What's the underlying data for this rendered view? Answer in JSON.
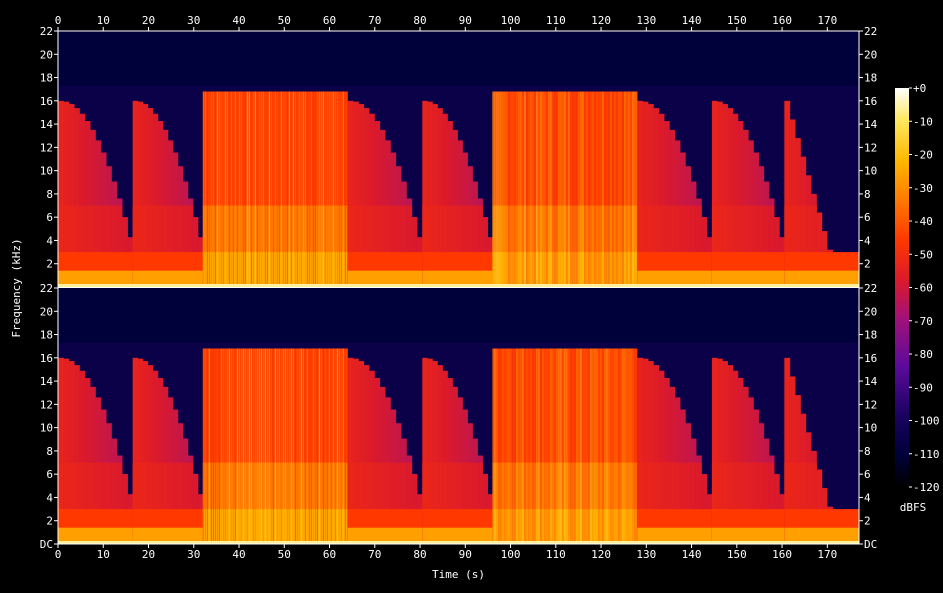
{
  "chart_data": {
    "type": "heatmap",
    "xlabel": "Time (s)",
    "ylabel": "Frequency (kHz)",
    "colorbar_label": "dBFS",
    "x_ticks": [
      0,
      10,
      20,
      30,
      40,
      50,
      60,
      70,
      80,
      90,
      100,
      110,
      120,
      130,
      140,
      150,
      160,
      170
    ],
    "xlim": [
      0,
      177
    ],
    "y_ticks": [
      "DC",
      "2",
      "4",
      "6",
      "8",
      "10",
      "12",
      "14",
      "16",
      "18",
      "20",
      "22"
    ],
    "ylim": [
      0,
      22
    ],
    "colorbar_ticks": [
      "+0",
      "-10",
      "-20",
      "-30",
      "-40",
      "-50",
      "-60",
      "-70",
      "-80",
      "-90",
      "-100",
      "-110",
      "-120"
    ],
    "colorbar_range": [
      -120,
      0
    ],
    "channels": [
      "ch1",
      "ch2"
    ],
    "segments": [
      {
        "start": 0,
        "end": 16.5,
        "kind": "decay"
      },
      {
        "start": 16.5,
        "end": 32,
        "kind": "decay"
      },
      {
        "start": 32,
        "end": 64,
        "kind": "full"
      },
      {
        "start": 64,
        "end": 80.5,
        "kind": "decay"
      },
      {
        "start": 80.5,
        "end": 96,
        "kind": "decay"
      },
      {
        "start": 96,
        "end": 128,
        "kind": "full"
      },
      {
        "start": 128,
        "end": 144.5,
        "kind": "decay"
      },
      {
        "start": 144.5,
        "end": 160.5,
        "kind": "decay"
      },
      {
        "start": 160.5,
        "end": 177,
        "kind": "tail"
      }
    ],
    "full_band_cutoff_khz": 16.8,
    "decay_cutoff_khz": 16.0,
    "grid": false
  }
}
